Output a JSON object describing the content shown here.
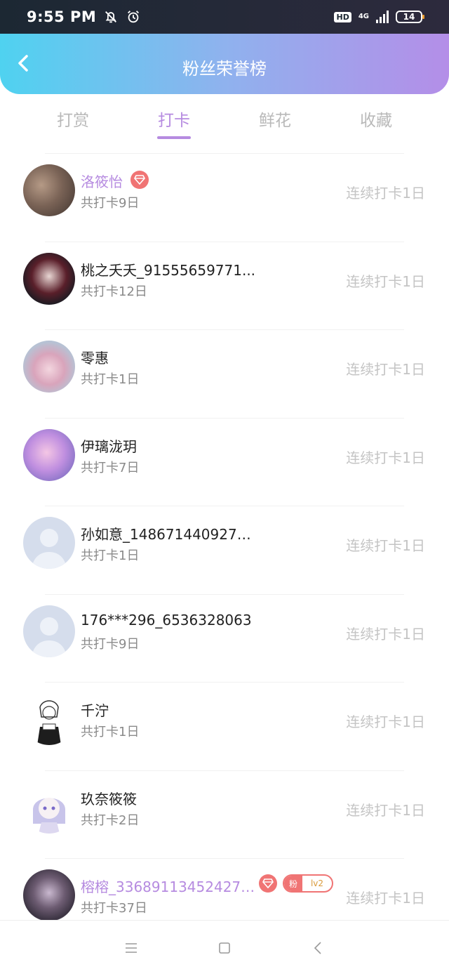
{
  "status_bar": {
    "time": "9:55 PM",
    "hd": "HD",
    "network": "4G",
    "battery": "14",
    "icons": [
      "bell-off-icon",
      "alarm-icon",
      "signal-icon",
      "battery-icon"
    ]
  },
  "header": {
    "title": "粉丝荣誉榜",
    "back_icon": "chevron-left-icon"
  },
  "tabs": [
    {
      "label": "打赏",
      "active": false
    },
    {
      "label": "打卡",
      "active": true
    },
    {
      "label": "鲜花",
      "active": false
    },
    {
      "label": "收藏",
      "active": false
    }
  ],
  "colors": {
    "accent": "#b68be0",
    "gem": "#f07474",
    "header_start": "#4fd2f0",
    "header_end": "#b48ee8"
  },
  "rows": [
    {
      "name": "洛筱怡",
      "sub": "共打卡9日",
      "streak": "连续打卡1日",
      "vip": true,
      "gem": true,
      "avatar": "photo-avatar"
    },
    {
      "name": "桃之夭夭_91555659771...",
      "sub": "共打卡12日",
      "streak": "连续打卡1日",
      "vip": false,
      "gem": false,
      "avatar": "anime-avatar"
    },
    {
      "name": "零惠",
      "sub": "共打卡1日",
      "streak": "连续打卡1日",
      "vip": false,
      "gem": false,
      "avatar": "anime-avatar"
    },
    {
      "name": "伊璃泷玥",
      "sub": "共打卡7日",
      "streak": "连续打卡1日",
      "vip": false,
      "gem": false,
      "avatar": "anime-avatar"
    },
    {
      "name": "孙如意_1486714409270...",
      "sub": "共打卡1日",
      "streak": "连续打卡1日",
      "vip": false,
      "gem": false,
      "avatar": "default-avatar"
    },
    {
      "name": "176***296_6536328063",
      "sub": "共打卡9日",
      "streak": "连续打卡1日",
      "vip": false,
      "gem": false,
      "avatar": "default-avatar"
    },
    {
      "name": "千泞",
      "sub": "共打卡1日",
      "streak": "连续打卡1日",
      "vip": false,
      "gem": false,
      "avatar": "sketch-avatar"
    },
    {
      "name": "玖奈筱筱",
      "sub": "共打卡2日",
      "streak": "连续打卡1日",
      "vip": false,
      "gem": false,
      "avatar": "anime-avatar"
    },
    {
      "name": "榕榕_336891134524278...",
      "sub": "共打卡37日",
      "streak": "连续打卡1日",
      "vip": true,
      "gem": true,
      "fan_label": "粉",
      "fan_level": "lv2",
      "avatar": "photo-avatar"
    }
  ],
  "nav_bar": {
    "icons": [
      "menu-icon",
      "home-square-icon",
      "back-triangle-icon"
    ]
  }
}
